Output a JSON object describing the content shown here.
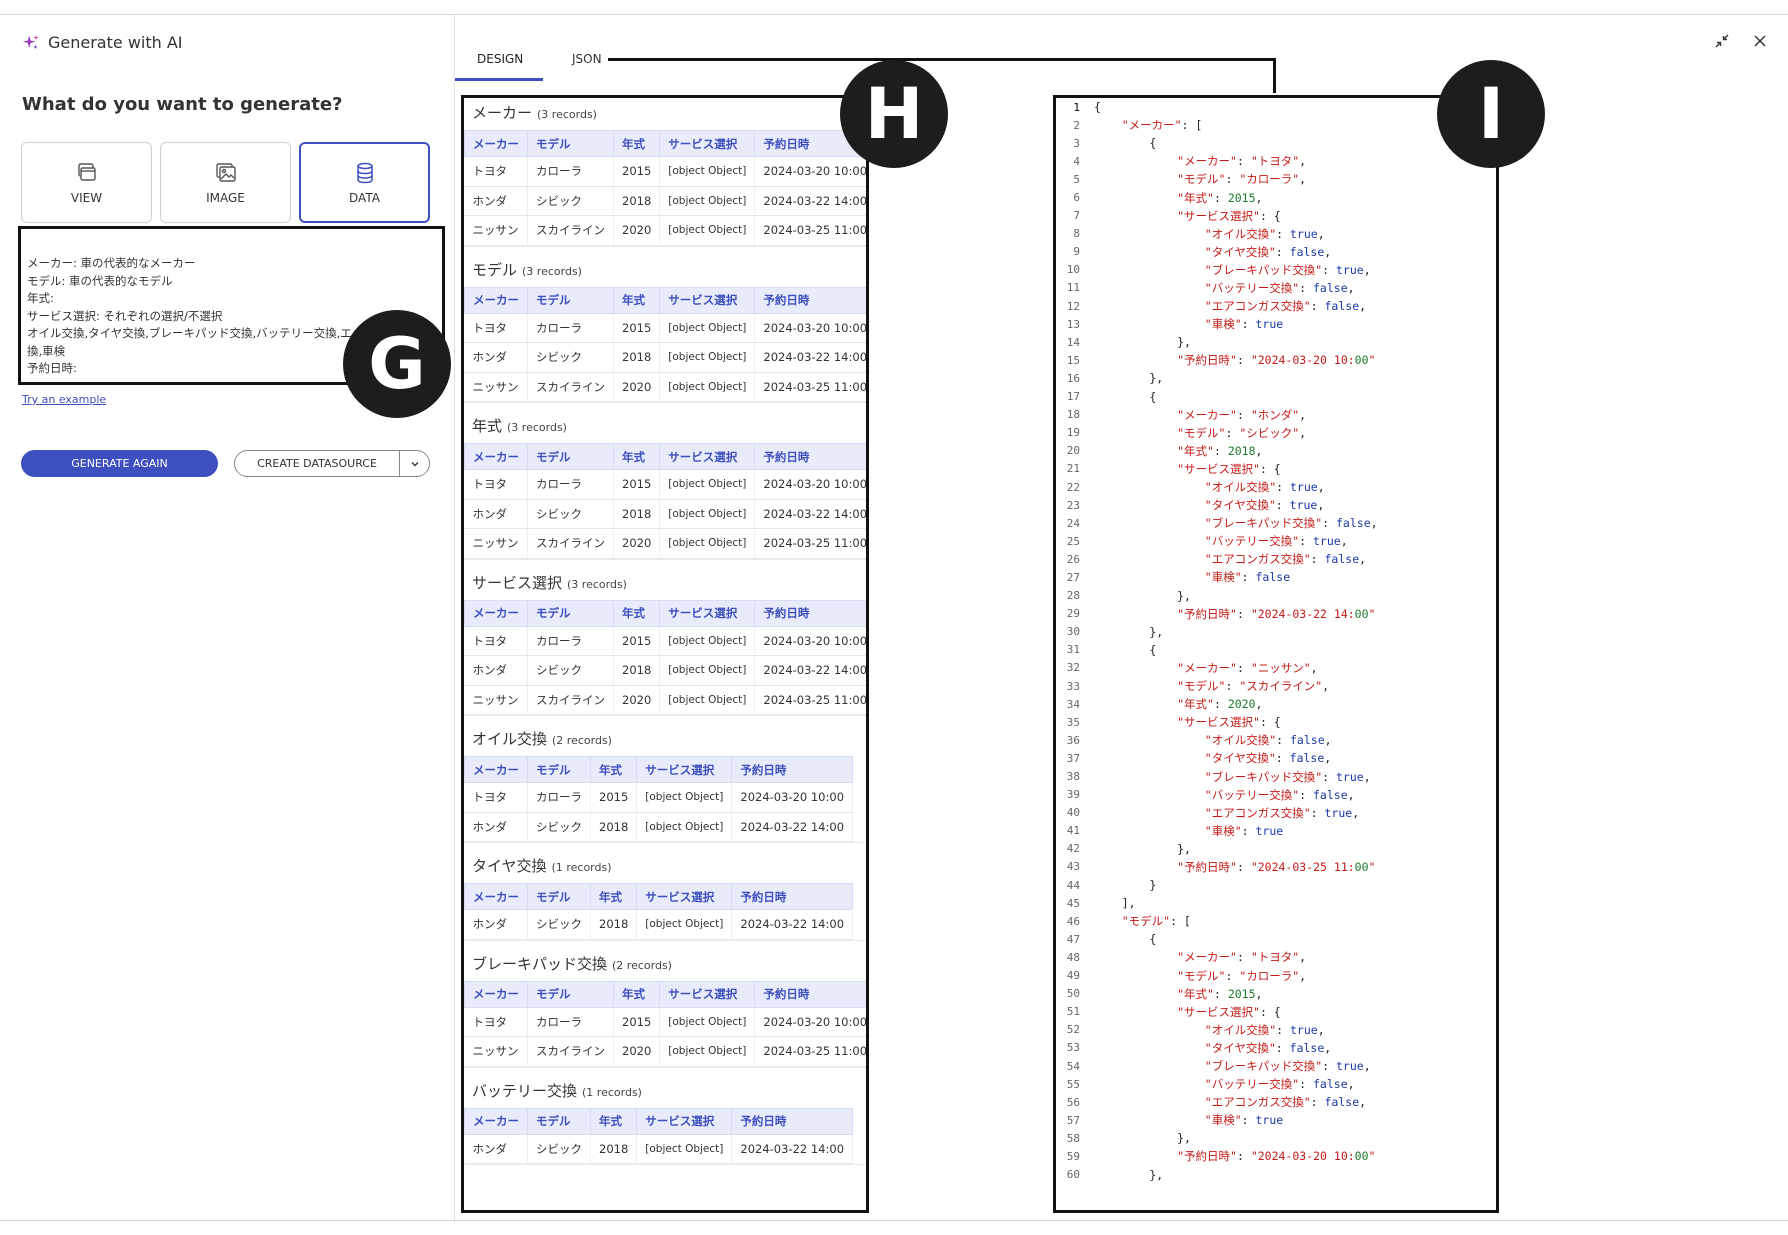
{
  "header": {
    "title": "Generate with AI"
  },
  "left": {
    "question": "What do you want to generate?",
    "types": [
      {
        "label": "VIEW",
        "icon": "view-icon"
      },
      {
        "label": "IMAGE",
        "icon": "image-icon"
      },
      {
        "label": "DATA",
        "icon": "database-icon",
        "active": true
      }
    ],
    "prompt_text": "メーカー: 車の代表的なメーカー\nモデル: 車の代表的なモデル\n年式:\nサービス選択: それぞれの選択/不選択\nオイル交換,タイヤ交換,ブレーキパッド交換,バッテリー交換,エ\n換,車検\n予約日時:",
    "try_example": "Try an example",
    "generate_again": "GENERATE AGAIN",
    "create_datasource": "CREATE DATASOURCE"
  },
  "tabs": {
    "design": "DESIGN",
    "json": "JSON"
  },
  "badges": {
    "g": "G",
    "h": "H",
    "i": "I"
  },
  "design": {
    "columns": [
      "メーカー",
      "モデル",
      "年式",
      "サービス選択",
      "予約日時"
    ],
    "tables": [
      {
        "title": "メーカー",
        "count": "(3 records)",
        "rows": [
          [
            "トヨタ",
            "カローラ",
            "2015",
            "[object Object]",
            "2024-03-20 10:00"
          ],
          [
            "ホンダ",
            "シビック",
            "2018",
            "[object Object]",
            "2024-03-22 14:00"
          ],
          [
            "ニッサン",
            "スカイライン",
            "2020",
            "[object Object]",
            "2024-03-25 11:00"
          ]
        ]
      },
      {
        "title": "モデル",
        "count": "(3 records)",
        "rows": [
          [
            "トヨタ",
            "カローラ",
            "2015",
            "[object Object]",
            "2024-03-20 10:00"
          ],
          [
            "ホンダ",
            "シビック",
            "2018",
            "[object Object]",
            "2024-03-22 14:00"
          ],
          [
            "ニッサン",
            "スカイライン",
            "2020",
            "[object Object]",
            "2024-03-25 11:00"
          ]
        ]
      },
      {
        "title": "年式",
        "count": "(3 records)",
        "rows": [
          [
            "トヨタ",
            "カローラ",
            "2015",
            "[object Object]",
            "2024-03-20 10:00"
          ],
          [
            "ホンダ",
            "シビック",
            "2018",
            "[object Object]",
            "2024-03-22 14:00"
          ],
          [
            "ニッサン",
            "スカイライン",
            "2020",
            "[object Object]",
            "2024-03-25 11:00"
          ]
        ]
      },
      {
        "title": "サービス選択",
        "count": "(3 records)",
        "rows": [
          [
            "トヨタ",
            "カローラ",
            "2015",
            "[object Object]",
            "2024-03-20 10:00"
          ],
          [
            "ホンダ",
            "シビック",
            "2018",
            "[object Object]",
            "2024-03-22 14:00"
          ],
          [
            "ニッサン",
            "スカイライン",
            "2020",
            "[object Object]",
            "2024-03-25 11:00"
          ]
        ]
      },
      {
        "title": "オイル交換",
        "count": "(2 records)",
        "rows": [
          [
            "トヨタ",
            "カローラ",
            "2015",
            "[object Object]",
            "2024-03-20 10:00"
          ],
          [
            "ホンダ",
            "シビック",
            "2018",
            "[object Object]",
            "2024-03-22 14:00"
          ]
        ]
      },
      {
        "title": "タイヤ交換",
        "count": "(1 records)",
        "rows": [
          [
            "ホンダ",
            "シビック",
            "2018",
            "[object Object]",
            "2024-03-22 14:00"
          ]
        ]
      },
      {
        "title": "ブレーキパッド交換",
        "count": "(2 records)",
        "rows": [
          [
            "トヨタ",
            "カローラ",
            "2015",
            "[object Object]",
            "2024-03-20 10:00"
          ],
          [
            "ニッサン",
            "スカイライン",
            "2020",
            "[object Object]",
            "2024-03-25 11:00"
          ]
        ]
      },
      {
        "title": "バッテリー交換",
        "count": "(1 records)",
        "rows": [
          [
            "ホンダ",
            "シビック",
            "2018",
            "[object Object]",
            "2024-03-22 14:00"
          ]
        ]
      }
    ]
  },
  "json_lines": [
    "{",
    "    \"メーカー\": [",
    "        {",
    "            \"メーカー\": \"トヨタ\",",
    "            \"モデル\": \"カローラ\",",
    "            \"年式\": 2015,",
    "            \"サービス選択\": {",
    "                \"オイル交換\": true,",
    "                \"タイヤ交換\": false,",
    "                \"ブレーキパッド交換\": true,",
    "                \"バッテリー交換\": false,",
    "                \"エアコンガス交換\": false,",
    "                \"車検\": true",
    "            },",
    "            \"予約日時\": \"2024-03-20 10:00\"",
    "        },",
    "        {",
    "            \"メーカー\": \"ホンダ\",",
    "            \"モデル\": \"シビック\",",
    "            \"年式\": 2018,",
    "            \"サービス選択\": {",
    "                \"オイル交換\": true,",
    "                \"タイヤ交換\": true,",
    "                \"ブレーキパッド交換\": false,",
    "                \"バッテリー交換\": true,",
    "                \"エアコンガス交換\": false,",
    "                \"車検\": false",
    "            },",
    "            \"予約日時\": \"2024-03-22 14:00\"",
    "        },",
    "        {",
    "            \"メーカー\": \"ニッサン\",",
    "            \"モデル\": \"スカイライン\",",
    "            \"年式\": 2020,",
    "            \"サービス選択\": {",
    "                \"オイル交換\": false,",
    "                \"タイヤ交換\": false,",
    "                \"ブレーキパッド交換\": true,",
    "                \"バッテリー交換\": false,",
    "                \"エアコンガス交換\": true,",
    "                \"車検\": true",
    "            },",
    "            \"予約日時\": \"2024-03-25 11:00\"",
    "        }",
    "    ],",
    "    \"モデル\": [",
    "        {",
    "            \"メーカー\": \"トヨタ\",",
    "            \"モデル\": \"カローラ\",",
    "            \"年式\": 2015,",
    "            \"サービス選択\": {",
    "                \"オイル交換\": true,",
    "                \"タイヤ交換\": false,",
    "                \"ブレーキパッド交換\": true,",
    "                \"バッテリー交換\": false,",
    "                \"エアコンガス交換\": false,",
    "                \"車検\": true",
    "            },",
    "            \"予約日時\": \"2024-03-20 10:00\"",
    "        },"
  ]
}
